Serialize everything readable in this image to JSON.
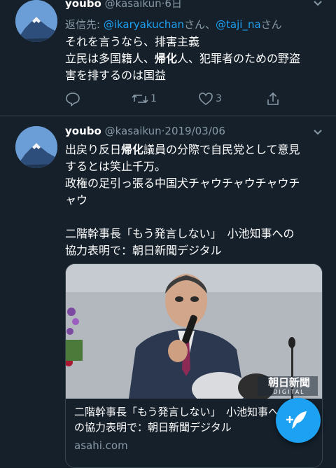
{
  "tweet1": {
    "display_name": "youbo",
    "handle": "@kasaikun",
    "separator": "·",
    "time": "6日",
    "reply_prefix": "返信先: ",
    "reply_user1": "@ikaryakuchan",
    "reply_san1": "さん、",
    "reply_user2": "@taji_na",
    "reply_san2": "さん",
    "body": {
      "line1": "それを言うなら、排害主義",
      "line2_a": "立民は多国籍人、",
      "line2_b": "帰化",
      "line2_c": "人、犯罪者のための野盗",
      "line3": "害を排するのは国益"
    },
    "retweet_count": "1",
    "like_count": "3"
  },
  "tweet2": {
    "display_name": "youbo",
    "handle": "@kasaikun",
    "separator": "·",
    "date": "2019/03/06",
    "body": {
      "line1_a": "出戻り反日",
      "line1_b": "帰化",
      "line1_c": "議員の分際で自民党として意見",
      "line2": "するとは笑止千万。",
      "line3": "政権の足引っ張る中国犬チャウチャウチャウチ",
      "line4": "ャウ",
      "line5": "二階幹事長「もう発言しない」　小池知事への",
      "line6": "協力表明で：朝日新聞デジタル"
    },
    "card": {
      "logo_text": "朝日新聞",
      "logo_sub": "DIGITAL",
      "title_line1": "二階幹事長「もう発言しない」　小池知事へ",
      "title_line2": "の協力表明で：朝日新聞デジタル",
      "domain": "asahi.com"
    }
  },
  "icons": {
    "avatar": "mountain-avatar-icon",
    "reply": "reply-icon",
    "retweet": "retweet-icon",
    "like": "heart-icon",
    "share": "share-icon",
    "menu": "chevron-down-icon",
    "compose": "compose-feather-icon"
  },
  "colors": {
    "background": "#15202b",
    "accent": "#1da1f2",
    "secondary_text": "#8899a6",
    "divider": "#38444d"
  }
}
